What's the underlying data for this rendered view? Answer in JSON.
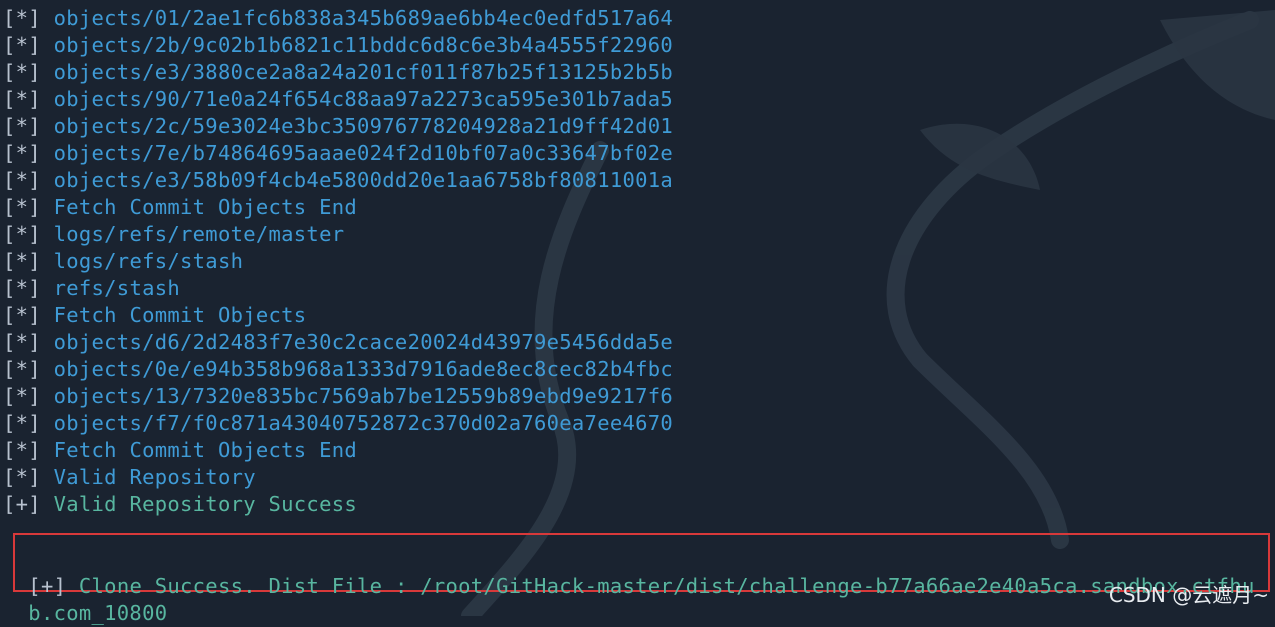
{
  "terminal": {
    "lines": [
      {
        "prefix": "[*]",
        "text": "objects/01/2ae1fc6b838a345b689ae6bb4ec0edfd517a64",
        "color": "blue"
      },
      {
        "prefix": "[*]",
        "text": "objects/2b/9c02b1b6821c11bddc6d8c6e3b4a4555f22960",
        "color": "blue"
      },
      {
        "prefix": "[*]",
        "text": "objects/e3/3880ce2a8a24a201cf011f87b25f13125b2b5b",
        "color": "blue"
      },
      {
        "prefix": "[*]",
        "text": "objects/90/71e0a24f654c88aa97a2273ca595e301b7ada5",
        "color": "blue"
      },
      {
        "prefix": "[*]",
        "text": "objects/2c/59e3024e3bc350976778204928a21d9ff42d01",
        "color": "blue"
      },
      {
        "prefix": "[*]",
        "text": "objects/7e/b74864695aaae024f2d10bf07a0c33647bf02e",
        "color": "blue"
      },
      {
        "prefix": "[*]",
        "text": "objects/e3/58b09f4cb4e5800dd20e1aa6758bf80811001a",
        "color": "blue"
      },
      {
        "prefix": "[*]",
        "text": "Fetch Commit Objects End",
        "color": "blue"
      },
      {
        "prefix": "[*]",
        "text": "logs/refs/remote/master",
        "color": "blue"
      },
      {
        "prefix": "[*]",
        "text": "logs/refs/stash",
        "color": "blue"
      },
      {
        "prefix": "[*]",
        "text": "refs/stash",
        "color": "blue"
      },
      {
        "prefix": "[*]",
        "text": "Fetch Commit Objects",
        "color": "blue"
      },
      {
        "prefix": "[*]",
        "text": "objects/d6/2d2483f7e30c2cace20024d43979e5456dda5e",
        "color": "blue"
      },
      {
        "prefix": "[*]",
        "text": "objects/0e/e94b358b968a1333d7916ade8ec8cec82b4fbc",
        "color": "blue"
      },
      {
        "prefix": "[*]",
        "text": "objects/13/7320e835bc7569ab7be12559b89ebd9e9217f6",
        "color": "blue"
      },
      {
        "prefix": "[*]",
        "text": "objects/f7/f0c871a43040752872c370d02a760ea7ee4670",
        "color": "blue"
      },
      {
        "prefix": "[*]",
        "text": "Fetch Commit Objects End",
        "color": "blue"
      },
      {
        "prefix": "[*]",
        "text": "Valid Repository",
        "color": "blue"
      },
      {
        "prefix": "[+]",
        "text": "Valid Repository Success",
        "color": "green"
      }
    ],
    "final_line_1": {
      "prefix": "[+]",
      "text": "Clone Success. Dist File : /root/GitHack-master/dist/challenge-b77a66ae2e40a5ca.sandbox.ctfhu"
    },
    "final_line_2": {
      "text": "b.com_10800"
    },
    "colors": {
      "background": "#1a2330",
      "blue_text": "#3f9bd6",
      "green_text": "#58b6a0",
      "bracket": "#b8c2cf",
      "highlight_border": "#d8393a"
    }
  },
  "watermark": {
    "label": "CSDN @云遮月~"
  }
}
